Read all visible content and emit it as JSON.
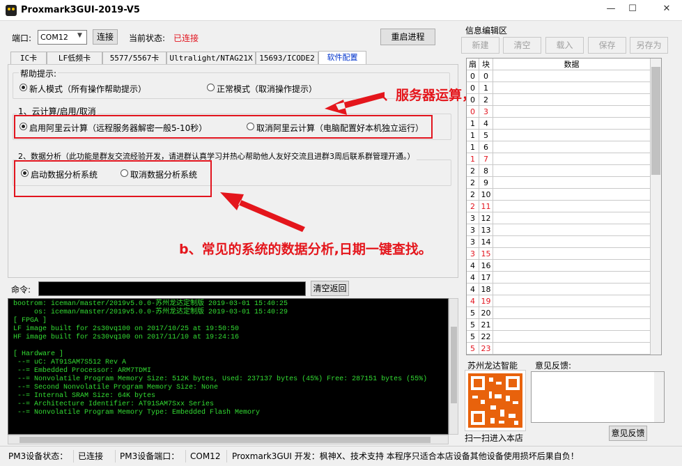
{
  "window": {
    "title": "Proxmark3GUI-2019-V5",
    "min_glyph": "—",
    "max_glyph": "☐",
    "close_glyph": "✕"
  },
  "top": {
    "port_label": "端口:",
    "port_value": "COM12",
    "connect_label": "连接",
    "state_label": "当前状态:",
    "state_value": "已连接",
    "restart_label": "重启进程",
    "state_color": "#e2141e"
  },
  "tabs": [
    {
      "label": "IC卡"
    },
    {
      "label": "LF低频卡"
    },
    {
      "label": "5577/5567卡"
    },
    {
      "label": "Ultralight/NTAG21X"
    },
    {
      "label": "15693/ICODE2"
    },
    {
      "label": "软件配置"
    }
  ],
  "help": {
    "title": "帮助提示:",
    "opt1": "新人模式（所有操作帮助提示）",
    "opt2": "正常模式（取消操作提示）"
  },
  "cloud": {
    "title": "1、云计算/启用/取消",
    "opt1": "启用阿里云计算（远程服务器解密一般5-10秒）",
    "opt2": "取消阿里云计算（电脑配置好本机独立运行）"
  },
  "analysis": {
    "title": "2、数据分析（此功能是群友交流经验开发，请进群认真学习并热心帮助他人友好交流且进群3周后联系群管理开通。）",
    "opt1": "启动数据分析系统",
    "opt2": "取消数据分析系统"
  },
  "annotations": {
    "a": "、服务器运算，本机运算  自己随意切换。",
    "b": "b、常见的系统的数据分析,日期一键查找。"
  },
  "command": {
    "label": "命令:",
    "value": "",
    "clear_label": "清空返回"
  },
  "console": {
    "lines": [
      "bootrom: iceman/master/2019v5.0.0-苏州龙达定制版 2019-03-01 15:40:25",
      "     os: iceman/master/2019v5.0.0-苏州龙达定制版 2019-03-01 15:40:29",
      "[ FPGA ]",
      "LF image built for 2s30vq100 on 2017/10/25 at 19:50:50",
      "HF image built for 2s30vq100 on 2017/11/10 at 19:24:16",
      "",
      "[ Hardware ]",
      " --= uC: AT91SAM7S512 Rev A",
      " --= Embedded Processor: ARM7TDMI",
      " --= Nonvolatile Program Memory Size: 512K bytes, Used: 237137 bytes (45%) Free: 287151 bytes (55%)",
      " --= Second Nonvolatile Program Memory Size: None",
      " --= Internal SRAM Size: 64K bytes",
      " --= Architecture Identifier: AT91SAM7Sxx Series",
      " --= Nonvolatile Program Memory Type: Embedded Flash Memory"
    ]
  },
  "editor": {
    "title": "信息编辑区",
    "buttons": [
      "新建",
      "清空",
      "载入",
      "保存",
      "另存为"
    ],
    "col_sector": "扇",
    "col_block": "块",
    "col_data": "数据",
    "rows": [
      {
        "s": "0",
        "b": "0",
        "red": false
      },
      {
        "s": "0",
        "b": "1",
        "red": false
      },
      {
        "s": "0",
        "b": "2",
        "red": false
      },
      {
        "s": "0",
        "b": "3",
        "red": true
      },
      {
        "s": "1",
        "b": "4",
        "red": false
      },
      {
        "s": "1",
        "b": "5",
        "red": false
      },
      {
        "s": "1",
        "b": "6",
        "red": false
      },
      {
        "s": "1",
        "b": "7",
        "red": true
      },
      {
        "s": "2",
        "b": "8",
        "red": false
      },
      {
        "s": "2",
        "b": "9",
        "red": false
      },
      {
        "s": "2",
        "b": "10",
        "red": false
      },
      {
        "s": "2",
        "b": "11",
        "red": true
      },
      {
        "s": "3",
        "b": "12",
        "red": false
      },
      {
        "s": "3",
        "b": "13",
        "red": false
      },
      {
        "s": "3",
        "b": "14",
        "red": false
      },
      {
        "s": "3",
        "b": "15",
        "red": true
      },
      {
        "s": "4",
        "b": "16",
        "red": false
      },
      {
        "s": "4",
        "b": "17",
        "red": false
      },
      {
        "s": "4",
        "b": "18",
        "red": false
      },
      {
        "s": "4",
        "b": "19",
        "red": true
      },
      {
        "s": "5",
        "b": "20",
        "red": false
      },
      {
        "s": "5",
        "b": "21",
        "red": false
      },
      {
        "s": "5",
        "b": "22",
        "red": false
      },
      {
        "s": "5",
        "b": "23",
        "red": true
      }
    ]
  },
  "shop": {
    "title": "苏州龙达智能",
    "caption": "扫一扫进入本店"
  },
  "feedback": {
    "title": "意见反馈:",
    "button": "意见反馈"
  },
  "status": {
    "dev_state_label": "PM3设备状态：",
    "dev_state": "已连接",
    "port_label": "PM3设备端口：",
    "port": "COM12",
    "credits": "Proxmark3GUI 开发：枫神X、技术支持  本程序只适合本店设备其他设备使用损坏后果自负！"
  }
}
